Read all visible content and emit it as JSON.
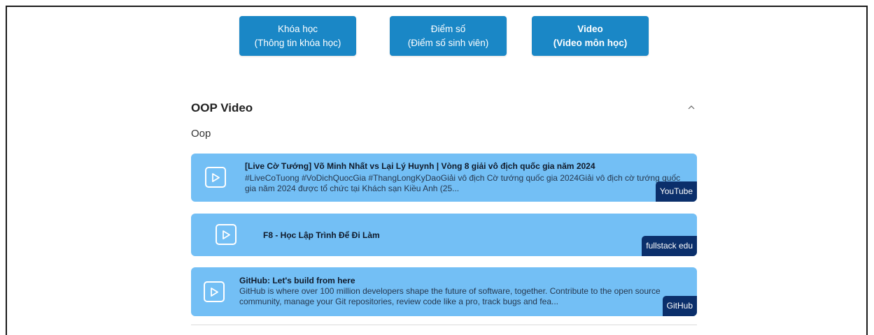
{
  "nav": {
    "courses": {
      "line1": "Khóa học",
      "line2": "(Thông tin khóa học)"
    },
    "scores": {
      "line1": "Điểm số",
      "line2": "(Điểm số sinh viên)"
    },
    "video": {
      "line1": "Video",
      "line2": "(Video môn học)"
    },
    "accent_color": "#1a87c6"
  },
  "section": {
    "title": "OOP Video",
    "description": "Oop",
    "collapse_icon": "chevron-up-icon"
  },
  "videos": [
    {
      "title": "[Live Cờ Tướng] Võ Minh Nhất vs Lại Lý Huynh | Vòng 8 giải vô địch quốc gia năm 2024",
      "desc_line1": "#LiveCoTuong #VoDichQuocGia #ThangLongKyDaoGiải vô địch Cờ tướng quốc gia 2024Giải vô địch cờ tướng quốc",
      "desc_line2": "gia năm 2024 được tổ chức tại Khách sạn Kiều Anh (25...",
      "source": "YouTube",
      "icon": "play-icon"
    },
    {
      "title": "F8 - Học Lập Trình Để Đi Làm",
      "source": "fullstack edu",
      "icon": "play-icon"
    },
    {
      "title": "GitHub: Let's build from here",
      "desc_line1": "GitHub is where over 100 million developers shape the future of software, together. Contribute to the open source",
      "desc_line2": "community, manage your Git repositories, review code like a pro, track bugs and fea...",
      "source": "GitHub",
      "icon": "play-icon"
    }
  ],
  "colors": {
    "card_bg": "#73bff5",
    "badge_bg": "#0b2f6b"
  }
}
